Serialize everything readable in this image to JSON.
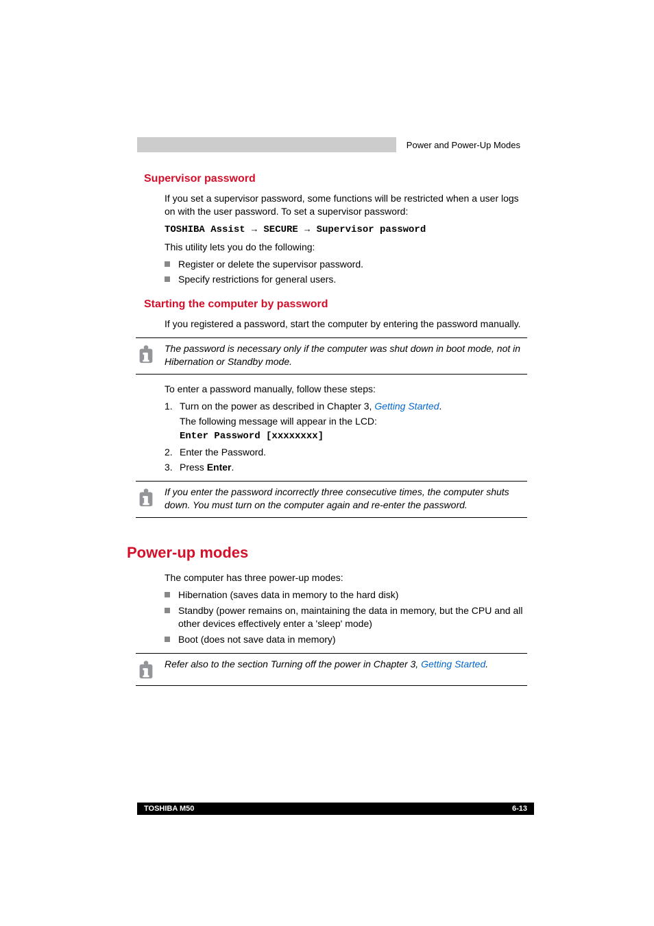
{
  "header": {
    "right": "Power and Power-Up Modes"
  },
  "s1": {
    "title": "Supervisor password",
    "p1": "If you set a supervisor password, some functions will be restricted when a user logs on with the user password. To set a supervisor password:",
    "path1": "TOSHIBA Assist",
    "path2": "SECURE",
    "path3": "Supervisor password",
    "p2": "This utility lets you do the following:",
    "b1": "Register or delete the supervisor password.",
    "b2": "Specify restrictions for general users."
  },
  "s2": {
    "title": "Starting the computer by password",
    "p1": "If you registered a password, start the computer by entering the password manually.",
    "note1": "The password is necessary only if the computer was shut down in boot mode, not in Hibernation or Standby mode.",
    "p2": "To enter a password manually, follow these steps:",
    "o1a": "Turn on the power as described in Chapter 3, ",
    "o1link": "Getting Started",
    "o1b": ".",
    "o1c": "The following message will appear in the LCD:",
    "o1d": "Enter Password [xxxxxxxx]",
    "o2": "Enter the Password.",
    "o3a": "Press ",
    "o3b": "Enter",
    "o3c": ".",
    "note2": "If you enter the password incorrectly three consecutive times, the computer shuts down. You must turn on the computer again and re-enter the password."
  },
  "s3": {
    "title": "Power-up modes",
    "p1": "The computer has three power-up modes:",
    "b1": "Hibernation (saves data in memory to the hard disk)",
    "b2": "Standby (power remains on, maintaining the data in memory, but the CPU and all other devices effectively enter a 'sleep' mode)",
    "b3": "Boot (does not save data in memory)",
    "note1a": "Refer also to the section Turning off the power in Chapter 3, ",
    "note1link": "Getting Started",
    "note1b": "."
  },
  "footer": {
    "left": "TOSHIBA M50",
    "right": "6-13"
  }
}
